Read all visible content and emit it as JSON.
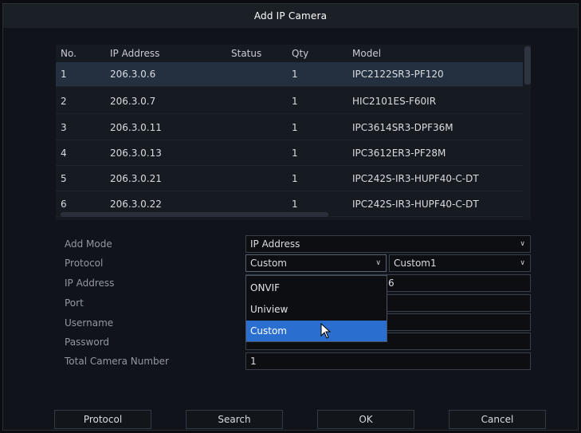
{
  "dialog": {
    "title": "Add IP Camera"
  },
  "table": {
    "headers": {
      "no": "No.",
      "ip": "IP Address",
      "status": "Status",
      "qty": "Qty",
      "model": "Model"
    },
    "rows": [
      {
        "no": "1",
        "ip": "206.3.0.6",
        "status": "",
        "qty": "1",
        "model": "IPC2122SR3-PF120"
      },
      {
        "no": "2",
        "ip": "206.3.0.7",
        "status": "",
        "qty": "1",
        "model": "HIC2101ES-F60IR"
      },
      {
        "no": "3",
        "ip": "206.3.0.11",
        "status": "",
        "qty": "1",
        "model": "IPC3614SR3-DPF36M"
      },
      {
        "no": "4",
        "ip": "206.3.0.13",
        "status": "",
        "qty": "1",
        "model": "IPC3612ER3-PF28M"
      },
      {
        "no": "5",
        "ip": "206.3.0.21",
        "status": "",
        "qty": "1",
        "model": "IPC242S-IR3-HUPF40-C-DT"
      },
      {
        "no": "6",
        "ip": "206.3.0.22",
        "status": "",
        "qty": "1",
        "model": "IPC242S-IR3-HUPF40-C-DT"
      }
    ]
  },
  "form": {
    "add_mode": {
      "label": "Add Mode",
      "value": "IP Address"
    },
    "protocol": {
      "label": "Protocol",
      "value": "Custom",
      "custom_value": "Custom1"
    },
    "ip_address": {
      "label": "IP Address",
      "value_visible": "6"
    },
    "port": {
      "label": "Port"
    },
    "username": {
      "label": "Username"
    },
    "password": {
      "label": "Password"
    },
    "total_camera_number": {
      "label": "Total Camera Number",
      "value": "1"
    }
  },
  "protocol_dropdown": {
    "options": [
      "ONVIF",
      "Uniview",
      "Custom"
    ],
    "highlighted": "Custom"
  },
  "buttons": {
    "protocol": "Protocol",
    "search": "Search",
    "ok": "OK",
    "cancel": "Cancel"
  },
  "colors": {
    "accent": "#2a6fcf",
    "selected_row": "#24303f"
  }
}
